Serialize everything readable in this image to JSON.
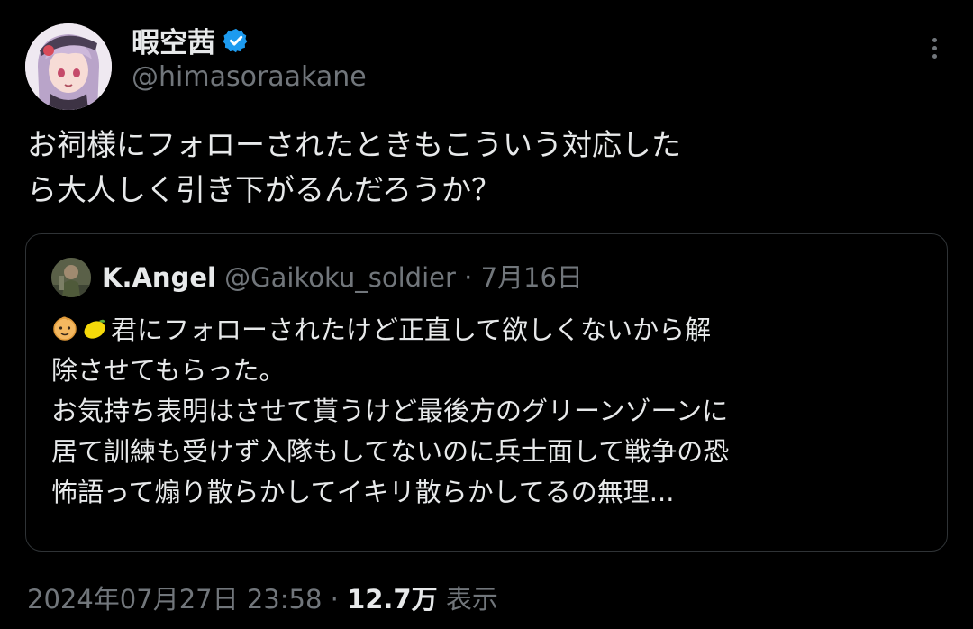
{
  "tweet": {
    "author": {
      "display_name": "暇空茜",
      "handle": "@himasoraakane",
      "verified_icon": "verified-badge-icon"
    },
    "text_lines": [
      "お祠様にフォローされたときもこういう対応した",
      "ら大人しく引き下がるんだろうか？"
    ],
    "timestamp": "2024年07月27日 23:58",
    "separator": "·",
    "views_count": "12.7万",
    "views_label": "表示"
  },
  "quote": {
    "author": {
      "display_name": "K.Angel",
      "handle": "@Gaikoku_soldier",
      "separator": "·",
      "date": "7月16日"
    },
    "emojis": [
      "baby-face-emoji",
      "lemon-emoji"
    ],
    "first_line_text": "君にフォローされたけど正直して欲しくないから解",
    "text_lines": [
      "除させてもらった。",
      "お気持ち表明はさせて貰うけど最後方のグリーンゾーンに",
      "居て訓練も受けず入隊もしてないのに兵士面して戦争の恐",
      "怖語って煽り散らかしてイキリ散らかしてるの無理..."
    ]
  },
  "colors": {
    "background": "#000000",
    "text_primary": "#e7e9ea",
    "text_secondary": "#71767b",
    "border": "#2f3336",
    "verified": "#1d9bf0"
  }
}
